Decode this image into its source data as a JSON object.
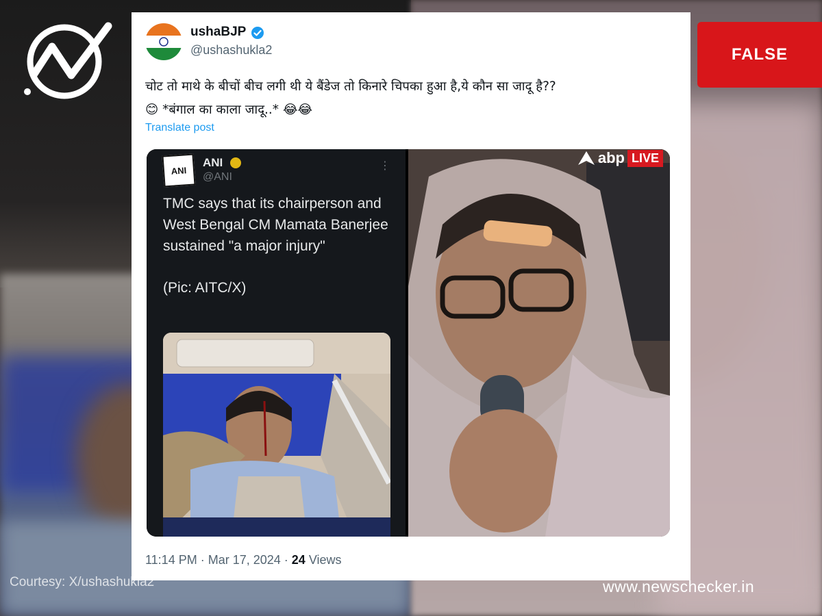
{
  "branding": {
    "logo_icon": "newschecker-check-icon",
    "verdict": "FALSE",
    "verdict_color": "#d8161a",
    "courtesy": "Courtesy: X/ushashukla2",
    "website": "www.newschecker.in"
  },
  "tweet": {
    "display_name": "ushaBJP",
    "handle": "@ushashukla2",
    "verified_icon": "verified-badge-icon",
    "text_line1": "चोट तो माथे के बीचों बीच लगी थी ये बैंडेज तो किनारे चिपका हुआ है,ये कौन सा जादू है??",
    "text_line2": "😊  *बंगाल का काला जादू..* 😂😂",
    "translate": "Translate post",
    "time": "11:14 PM · Mar 17, 2024 · ",
    "views_count": "24",
    "views_label": " Views"
  },
  "embedded_post": {
    "account": "ANI",
    "handle": "@ANI",
    "logo_text": "ANI",
    "more_icon": "⋮",
    "text": "TMC says that its chairperson and West Bengal CM Mamata Banerjee sustained \"a major injury\"",
    "pic_credit": "(Pic: AITC/X)"
  },
  "video_frame": {
    "channel": "abp",
    "live_label": "LIVE"
  }
}
